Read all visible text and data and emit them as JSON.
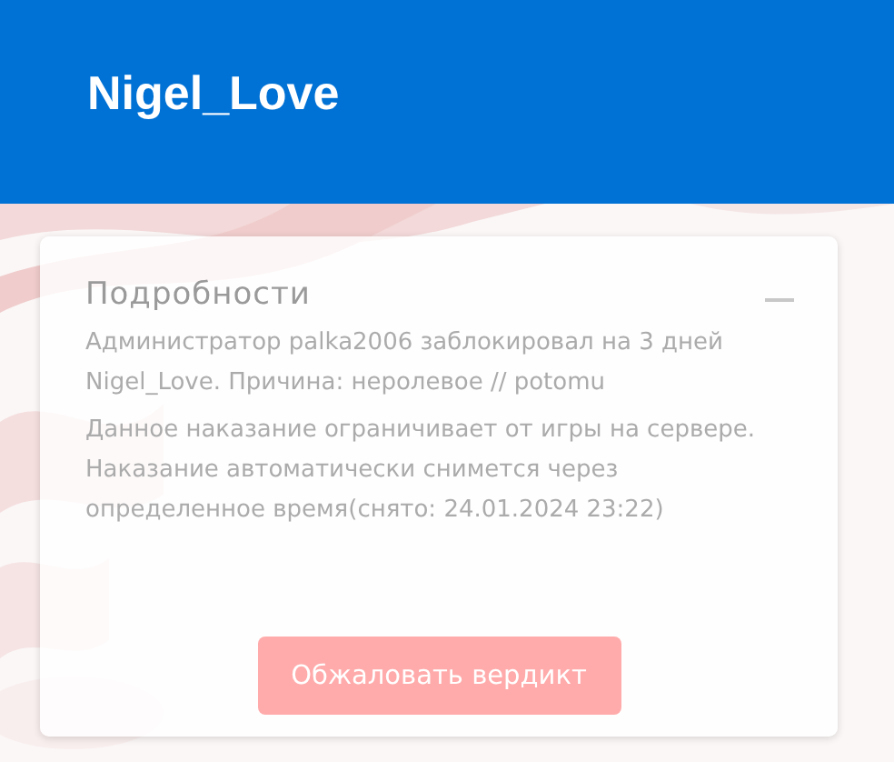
{
  "header": {
    "title": "Nigel_Love"
  },
  "details": {
    "title": "Подробности",
    "expanded": true,
    "paragraphs": [
      "Администратор palka2006 заблокировал на 3 дней Nigel_Love. Причина: неролевое // potomu",
      "Данное наказание ограничивает от игры на сервере. Наказание автоматически снимется через определенное время(снято: 24.01.2024 23:22)"
    ],
    "button": "Обжаловать вердикт"
  }
}
